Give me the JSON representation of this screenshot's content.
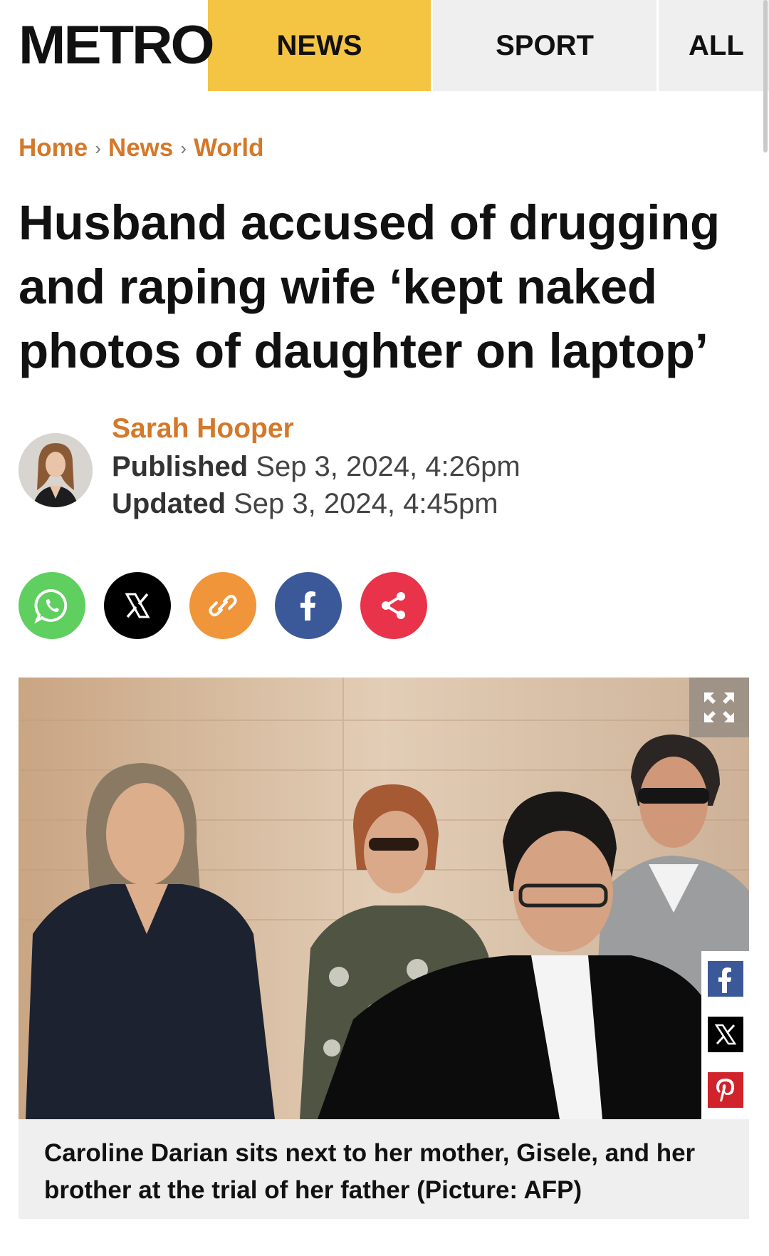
{
  "header": {
    "logo": "METRO",
    "tabs": [
      {
        "label": "NEWS"
      },
      {
        "label": "SPORT"
      },
      {
        "label": "ALL"
      }
    ]
  },
  "breadcrumb": {
    "items": [
      "Home",
      "News",
      "World"
    ],
    "separator": "›"
  },
  "article": {
    "headline": "Husband accused of drugging and raping wife ‘kept naked photos of daughter on laptop’",
    "author": "Sarah Hooper",
    "published_label": "Published",
    "published_value": "Sep 3, 2024, 4:26pm",
    "updated_label": "Updated",
    "updated_value": "Sep 3, 2024, 4:45pm"
  },
  "share": {
    "buttons": [
      {
        "name": "whatsapp-icon",
        "color": "#5fcf5f"
      },
      {
        "name": "x-icon",
        "color": "#000000"
      },
      {
        "name": "link-icon",
        "color": "#f0953a"
      },
      {
        "name": "facebook-icon",
        "color": "#3b5998"
      },
      {
        "name": "share-icon",
        "color": "#e8334a"
      }
    ]
  },
  "image": {
    "caption": "Caroline Darian sits next to her mother, Gisele, and her brother at the trial of her father (Picture: AFP)",
    "side_share": [
      "facebook-icon",
      "x-icon",
      "pinterest-icon"
    ]
  },
  "colors": {
    "accent": "#d4782a",
    "nav_active": "#f4c443",
    "nav_inactive": "#efefef"
  }
}
